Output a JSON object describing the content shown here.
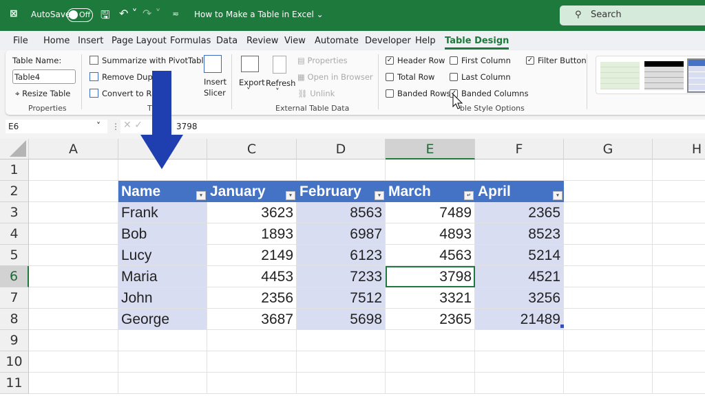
{
  "titlebar": {
    "autosave_label": "AutoSave",
    "autosave_state": "Off",
    "doc_title": "How to Make a Table in Excel ⌄",
    "search_placeholder": "Search",
    "accent": "#1e7a3c"
  },
  "menu": [
    "File",
    "Home",
    "Insert",
    "Page Layout",
    "Formulas",
    "Data",
    "Review",
    "View",
    "Automate",
    "Developer",
    "Help",
    "Table Design"
  ],
  "active_tab": "Table Design",
  "ribbon": {
    "properties": {
      "label": "Table Name:",
      "table_name": "Table4",
      "resize": "Resize Table",
      "group": "Properties"
    },
    "tools": {
      "pivot": "Summarize with PivotTable",
      "remove_dup": "Remove Duplic",
      "convert": "Convert to Ran",
      "insert_slicer_1": "Insert",
      "insert_slicer_2": "Slicer",
      "group": "T"
    },
    "external": {
      "export": "Export",
      "refresh": "Refresh",
      "properties": "Properties",
      "open_browser": "Open in Browser",
      "unlink": "Unlink",
      "group": "External Table Data"
    },
    "style_options": {
      "group": "ble Style Options",
      "options": [
        {
          "label": "Header Row",
          "checked": true
        },
        {
          "label": "Total Row",
          "checked": false
        },
        {
          "label": "Banded Rows",
          "checked": false
        },
        {
          "label": "First Column",
          "checked": false
        },
        {
          "label": "Last Column",
          "checked": false
        },
        {
          "label": "Banded Columns",
          "checked": true
        },
        {
          "label": "Filter Button",
          "checked": true
        }
      ]
    }
  },
  "formula_bar": {
    "name_box": "E6",
    "value": "3798"
  },
  "sheet": {
    "columns": [
      "A",
      "",
      "C",
      "D",
      "E",
      "F",
      "G",
      "H"
    ],
    "rows": [
      "1",
      "2",
      "3",
      "4",
      "5",
      "6",
      "7",
      "8",
      "9",
      "10",
      "11"
    ],
    "selected_cell": "E6",
    "table": {
      "headers": [
        "Name",
        "January",
        "February",
        "March",
        "April"
      ],
      "rows": [
        [
          "Frank",
          "3623",
          "8563",
          "7489",
          "2365"
        ],
        [
          "Bob",
          "1893",
          "6987",
          "4893",
          "8523"
        ],
        [
          "Lucy",
          "2149",
          "6123",
          "4563",
          "5214"
        ],
        [
          "Maria",
          "4453",
          "7233",
          "3798",
          "4521"
        ],
        [
          "John",
          "2356",
          "7512",
          "3321",
          "3256"
        ],
        [
          "George",
          "3687",
          "5698",
          "2365",
          "21489"
        ]
      ],
      "header_color": "#4472c4",
      "band_color": "#d9ddf2"
    }
  },
  "annotation": {
    "arrow_color": "#1f3fb0"
  }
}
